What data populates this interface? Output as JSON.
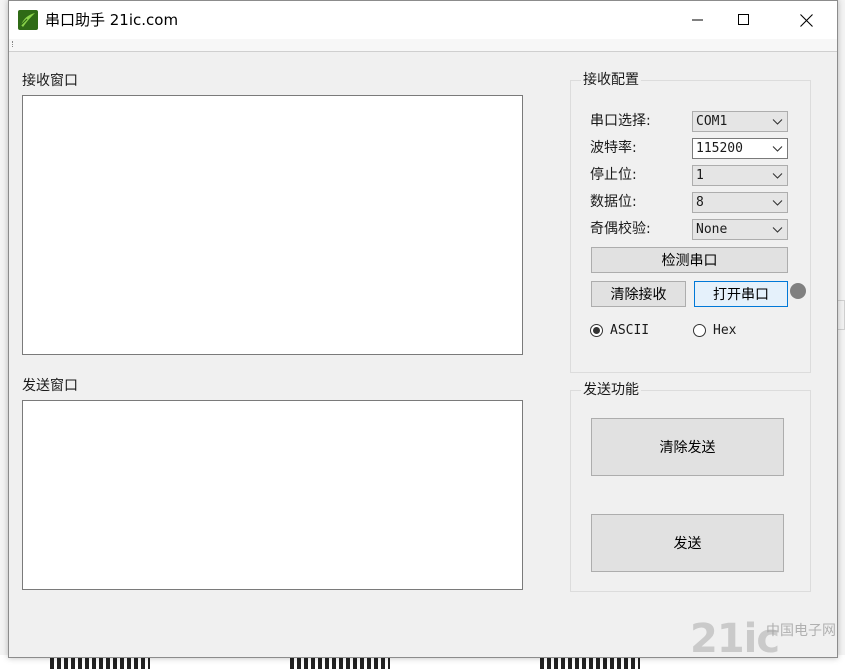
{
  "window": {
    "title": "串口助手  21ic.com"
  },
  "receive_window": {
    "label": "接收窗口",
    "content": ""
  },
  "send_window": {
    "label": "发送窗口",
    "content": ""
  },
  "receive_config": {
    "title": "接收配置",
    "fields": [
      {
        "label": "串口选择:",
        "value": "COM1",
        "editable": false
      },
      {
        "label": "波特率:",
        "value": "115200",
        "editable": true
      },
      {
        "label": "停止位:",
        "value": "1",
        "editable": false
      },
      {
        "label": "数据位:",
        "value": "8",
        "editable": false
      },
      {
        "label": "奇偶校验:",
        "value": "None",
        "editable": false
      }
    ],
    "detect_button": "检测串口",
    "clear_receive_button": "清除接收",
    "open_port_button": "打开串口",
    "status_led_color": "#808080",
    "mode_options": [
      {
        "label": "ASCII",
        "checked": true
      },
      {
        "label": "Hex",
        "checked": false
      }
    ]
  },
  "send_function": {
    "title": "发送功能",
    "clear_send_button": "清除发送",
    "send_button": "发送"
  },
  "background": {
    "watermark": "21ic",
    "watermark_sub": "中国电子网"
  },
  "colors": {
    "accent_focus": "#0078d7",
    "app_icon_green": "#4caf2a"
  }
}
